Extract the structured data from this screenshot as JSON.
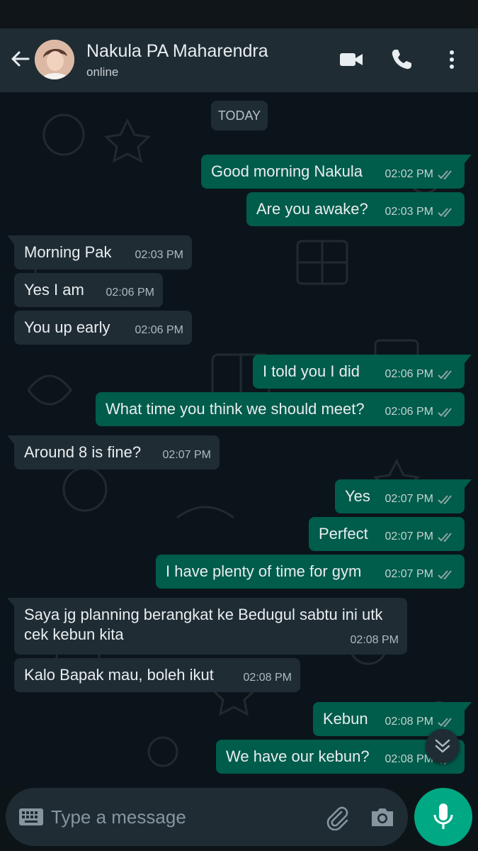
{
  "header": {
    "contact_name": "Nakula PA Maharendra",
    "status": "online",
    "icons": [
      "back-arrow-icon",
      "avatar",
      "video-call-icon",
      "phone-icon",
      "more-vert-icon"
    ]
  },
  "chat": {
    "date_chip": "TODAY",
    "messages": [
      {
        "dir": "out",
        "text": "Good morning Nakula",
        "time": "02:02 PM",
        "status": "read"
      },
      {
        "dir": "out",
        "text": "Are you awake?",
        "time": "02:03 PM",
        "status": "read"
      },
      {
        "dir": "in",
        "text": "Morning Pak",
        "time": "02:03 PM"
      },
      {
        "dir": "in",
        "text": "Yes I am",
        "time": "02:06 PM"
      },
      {
        "dir": "in",
        "text": "You up early",
        "time": "02:06 PM"
      },
      {
        "dir": "out",
        "text": "I told you I did",
        "time": "02:06 PM",
        "status": "read"
      },
      {
        "dir": "out",
        "text": "What time you think we should meet?",
        "time": "02:06 PM",
        "status": "read"
      },
      {
        "dir": "in",
        "text": "Around 8 is fine?",
        "time": "02:07 PM"
      },
      {
        "dir": "out",
        "text": "Yes",
        "time": "02:07 PM",
        "status": "read"
      },
      {
        "dir": "out",
        "text": "Perfect",
        "time": "02:07 PM",
        "status": "read"
      },
      {
        "dir": "out",
        "text": "I have plenty of time for gym",
        "time": "02:07 PM",
        "status": "read"
      },
      {
        "dir": "in",
        "text_line1": "Saya jg planning berangkat ke Bedugul sabtu ini utk",
        "text_line2": "cek kebun kita",
        "time": "02:08 PM"
      },
      {
        "dir": "in",
        "text": "Kalo Bapak mau, boleh ikut",
        "time": "02:08 PM"
      },
      {
        "dir": "out",
        "text": "Kebun",
        "time": "02:08 PM",
        "status": "read"
      },
      {
        "dir": "out",
        "text": "We have our kebun?",
        "time": "02:08 PM",
        "status": "read"
      }
    ]
  },
  "composer": {
    "placeholder": "Type a message",
    "icons": [
      "keyboard-icon",
      "attach-icon",
      "camera-icon",
      "mic-icon"
    ]
  },
  "colors": {
    "outgoing_bubble": "#005c4b",
    "incoming_bubble": "#1f2c34",
    "accent": "#00a884",
    "read_ticks": "#8aa6a0"
  }
}
